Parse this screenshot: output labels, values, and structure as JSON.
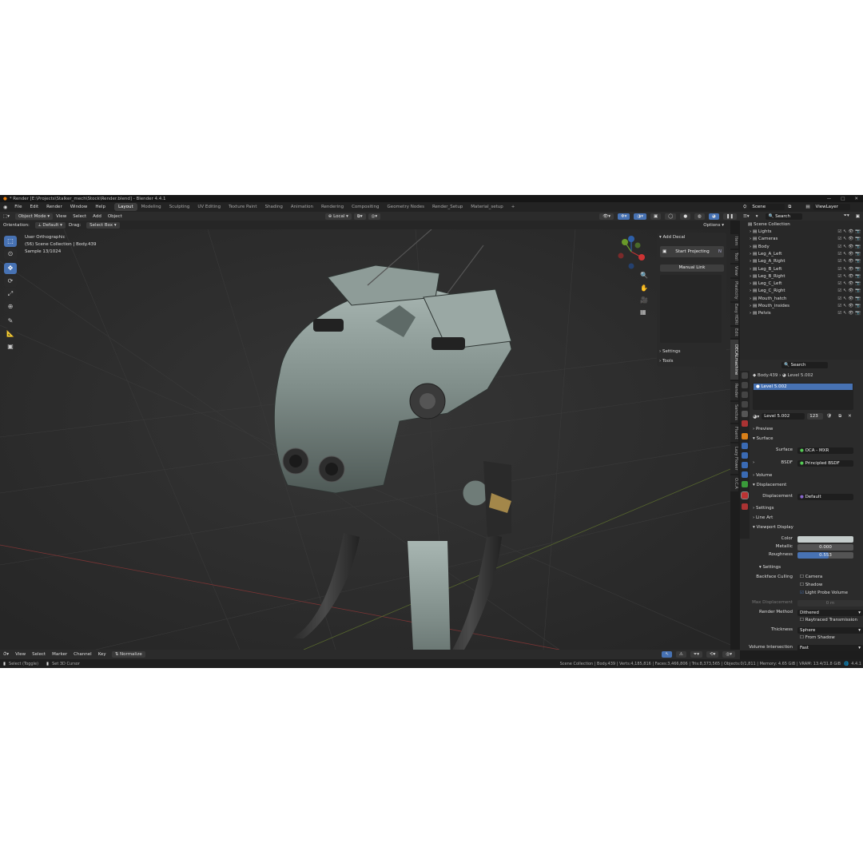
{
  "window": {
    "title": "* Render [E:\\Projects\\Stalker_mech\\Stock\\Render.blend] - Blender 4.4.1"
  },
  "menu": [
    "File",
    "Edit",
    "Render",
    "Window",
    "Help"
  ],
  "workspaces": [
    "Layout",
    "Modeling",
    "Sculpting",
    "UV Editing",
    "Texture Paint",
    "Shading",
    "Animation",
    "Rendering",
    "Compositing",
    "Geometry Nodes",
    "Render_Setup",
    "Material_setup"
  ],
  "active_workspace": "Layout",
  "viewport_header": {
    "mode": "Object Mode",
    "view": "View",
    "select": "Select",
    "add": "Add",
    "object": "Object",
    "pivot": "Local"
  },
  "tool_header": {
    "orientation_label": "Orientation:",
    "orientation": "Default",
    "drag_label": "Drag:",
    "drag": "Select Box",
    "options": "Options"
  },
  "viewport_info": {
    "line1": "User Orthographic",
    "line2": "(56) Scene Collection | Body.439",
    "line3": "Sample 13/1024"
  },
  "decal_panel": {
    "title": "Add Decal",
    "start": "Start Projecting",
    "manual": "Manual Link",
    "settings": "Settings",
    "tools": "Tools"
  },
  "npanel_tabs": [
    "Item",
    "Tool",
    "View",
    "Plasticity",
    "Easy HDRI",
    "Edit",
    "DECALmachine",
    "Render",
    "Sanctus",
    "Fluent",
    "Lazy Flower",
    "O.C.A"
  ],
  "scene": {
    "name": "Scene",
    "view_layer": "ViewLayer",
    "search": "Search"
  },
  "outliner": {
    "root": "Scene Collection",
    "items": [
      "Lights",
      "Cameras",
      "Body",
      "Leg_A_Left",
      "Leg_A_Right",
      "Leg_B_Left",
      "Leg_B_Right",
      "Leg_C_Left",
      "Leg_C_Right",
      "Mouth_hatch",
      "Mouth_insides",
      "Pelvis"
    ]
  },
  "props": {
    "search": "Search",
    "object": "Body.439",
    "material": "Level 5.002",
    "slot": "Level 5.002",
    "users": "123",
    "sections": {
      "preview": "Preview",
      "surface": "Surface",
      "volume": "Volume",
      "displacement": "Displacement",
      "settings": "Settings",
      "line_art": "Line Art",
      "viewport_display": "Viewport Display",
      "vd_settings": "Settings"
    },
    "surface_label": "Surface",
    "surface_value": "OCA - MXR",
    "bsdf_label": "BSDF",
    "bsdf_value": "Principled BSDF",
    "disp_label": "Displacement",
    "disp_value": "Default",
    "color_label": "Color",
    "metallic_label": "Metallic",
    "metallic_value": "0.000",
    "rough_label": "Roughness",
    "rough_value": "0.553",
    "roughness": 0.553,
    "backface_label": "Backface Culling",
    "camera": "Camera",
    "shadow": "Shadow",
    "light_probe": "Light Probe Volume",
    "maxdisp_label": "Max Displacement",
    "maxdisp_value": "0 m",
    "render_method_label": "Render Method",
    "render_method": "Dithered",
    "raytraced": "Raytraced Transmission",
    "thickness_label": "Thickness",
    "thickness": "Sphere",
    "from_shadow": "From Shadow",
    "vol_int_label": "Volume Intersection",
    "vol_int": "Fast"
  },
  "timeline": {
    "view": "View",
    "select": "Select",
    "marker": "Marker",
    "channel": "Channel",
    "key": "Key",
    "normalize": "Normalize"
  },
  "status": {
    "left1": "Select (Toggle)",
    "left2": "Set 3D Cursor",
    "right": "Scene Collection | Body.439 | Verts:4,185,816 | Faces:3,466,806 | Tris:8,373,565 | Objects:0/1,811 | Memory: 4.65 GiB | VRAM: 13.4/31.8 GiB",
    "version": "4.4.1"
  },
  "colors": {
    "accent": "#4772b3",
    "bg": "#2e2e2e",
    "metal": "#8e9c98"
  }
}
